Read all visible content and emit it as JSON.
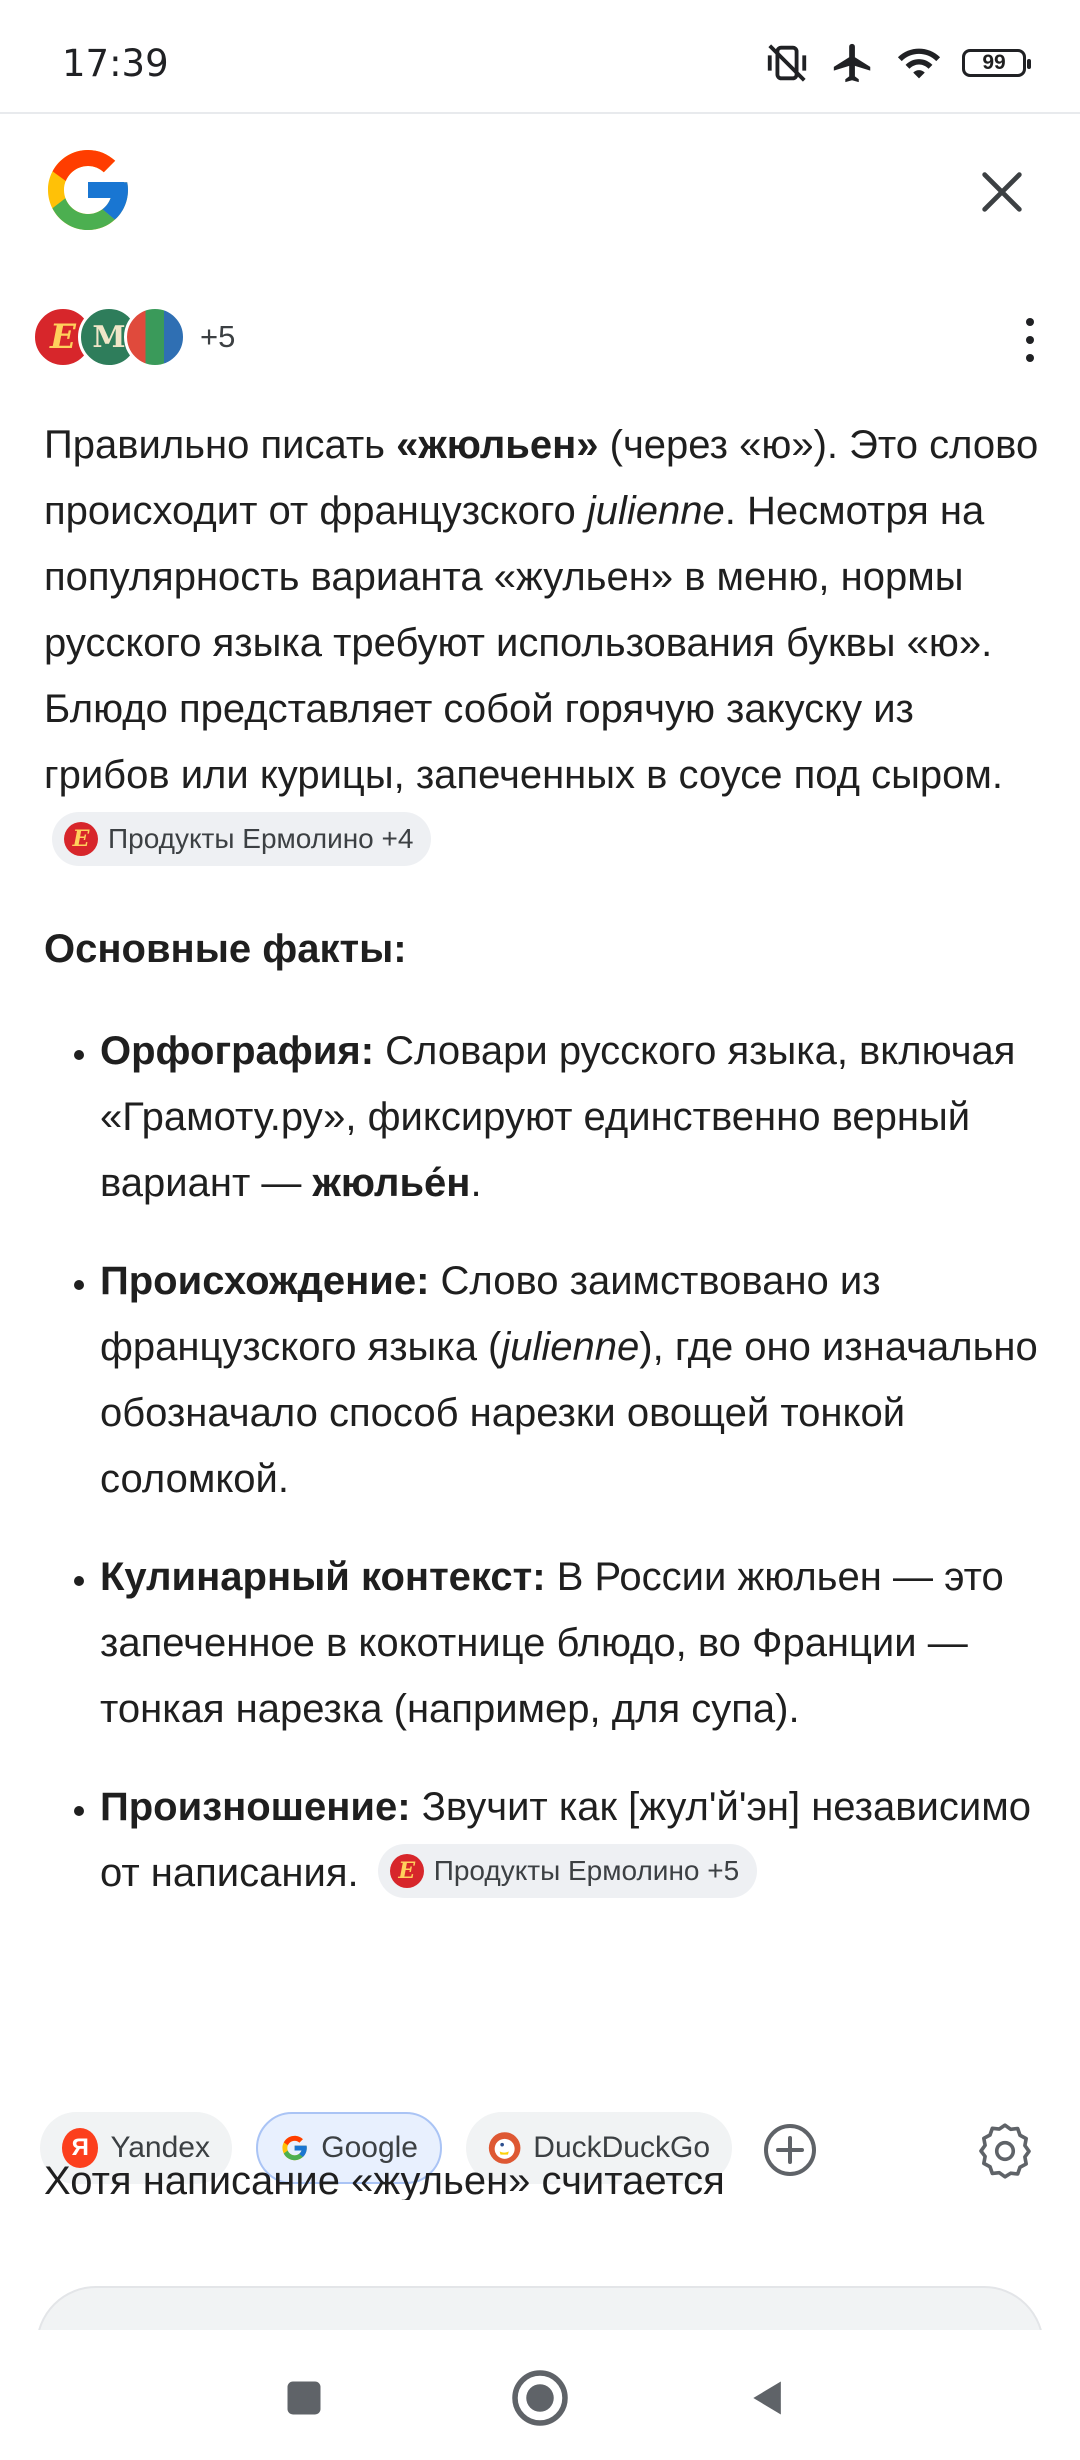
{
  "status_bar": {
    "time": "17:39",
    "battery": "99",
    "icons": [
      "vibrate-off-icon",
      "airplane-icon",
      "wifi-icon",
      "battery-icon"
    ]
  },
  "header": {
    "logo": "google-logo",
    "close_icon": "close-icon"
  },
  "sources": {
    "avatars": [
      "Ермолино",
      "М",
      "books"
    ],
    "more": "+5"
  },
  "answer": {
    "intro": {
      "t1": "Правильно писать ",
      "b1": "«жюльен»",
      "t2": " (через «ю»). Это слово происходит от французского ",
      "i1": "julienne",
      "t3": ". Несмотря на популярность варианта «жульен» в меню, нормы русского языка требуют использования буквы «ю». Блюдо представляет собой горячую закуску из грибов или курицы, запеченных в соусе под сыром.",
      "chip": "Продукты Ермолино +4"
    },
    "facts_title": "Основные факты:",
    "facts": [
      {
        "title": "Орфография:",
        "text": " Словари русского языка, включая «Грамоту.ру», фиксируют единственно верный вариант — ",
        "bold": "жюлье́н",
        "end": "."
      },
      {
        "title": "Происхождение:",
        "text": " Слово заимствовано из французского языка (",
        "italic": "julienne",
        "end": "), где оно изначально обозначало способ нарезки овощей тонкой соломкой."
      },
      {
        "title": "Кулинарный контекст:",
        "text": " В России жюльен — это запеченное в кокотнице блюдо, во Франции — тонкая нарезка (например, для супа)."
      },
      {
        "title": "Произношение:",
        "text": " Звучит как [жул'й'эн] независимо от написания.",
        "chip": "Продукты Ермолино +5"
      }
    ],
    "cutoff_line": "Хотя написание «жульен» считается"
  },
  "engines": [
    {
      "label": "Yandex",
      "icon": "yandex-icon",
      "active": false
    },
    {
      "label": "Google",
      "icon": "google-icon",
      "active": true
    },
    {
      "label": "DuckDuckGo",
      "icon": "duckduckgo-icon",
      "active": false
    }
  ],
  "colors": {
    "google_blue": "#4285F4",
    "google_red": "#EA4335",
    "google_yellow": "#FBBC05",
    "google_green": "#34A853",
    "active_chip": "#e8f0fe"
  }
}
